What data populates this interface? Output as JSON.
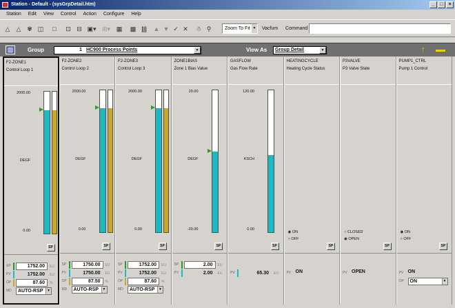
{
  "window": {
    "title": "Station - Default - (sysGrpDetail.htm)",
    "controls": [
      "_",
      "□",
      "×"
    ]
  },
  "menu": [
    "Station",
    "Edit",
    "View",
    "Control",
    "Action",
    "Configure",
    "Help"
  ],
  "toolbar": {
    "icons": [
      "alarm-bell-icon",
      "alarm-summary-icon",
      "operator-icon",
      "display-icon",
      "page-icon",
      "prev-display-icon",
      "next-display-icon",
      "history-icon",
      "back-icon",
      "forward-icon",
      "detail-icon",
      "trend-icon",
      "raise-icon",
      "lower-icon",
      "acknowledge-icon",
      "cancel-icon",
      "associated-display-icon",
      "find-icon"
    ],
    "zoom_value": "Zoom To Fit",
    "vacuum_label": "Vacfum",
    "command_label": "Command",
    "command_value": ""
  },
  "group_bar": {
    "group_label": "Group",
    "group_number": "1",
    "group_name": "HC900 Process Points",
    "view_label": "View As",
    "view_value": "Group Detail"
  },
  "row_labels": {
    "sp": "SP",
    "pv": "PV",
    "op": "OP",
    "mode": "MD"
  },
  "units": {
    "sp": "EU",
    "pv": "EU",
    "op": "%"
  },
  "columns": [
    {
      "name": "F2-ZONE1",
      "desc": "Control Loop 1",
      "type": "loop",
      "selected": true,
      "scale_hi": "2000.00",
      "scale_mid": "DEGF",
      "scale_lo": "0.00",
      "pv_fraction": 0.87,
      "sp_fraction": 0.87,
      "op_fraction": 0.87,
      "sp": "1752.00",
      "pv": "1752.00",
      "op": "87.60",
      "mode": "AUTO-RSP",
      "btn": "SP"
    },
    {
      "name": "F2-ZONE2",
      "desc": "Control Loop 2",
      "type": "loop",
      "selected": false,
      "scale_hi": "2000.00",
      "scale_mid": "DEGF",
      "scale_lo": "0.00",
      "pv_fraction": 0.875,
      "sp_fraction": 0.875,
      "op_fraction": 0.875,
      "sp": "1750.00",
      "pv": "1750.00",
      "op": "87.50",
      "mode": "AUTO-RSP",
      "btn": "SP"
    },
    {
      "name": "F2-ZONE3",
      "desc": "Control Loop 3",
      "type": "loop",
      "selected": false,
      "scale_hi": "2000.00",
      "scale_mid": "DEGF",
      "scale_lo": "0.00",
      "pv_fraction": 0.876,
      "sp_fraction": 0.876,
      "op_fraction": 0.876,
      "sp": "1752.00",
      "pv": "1752.00",
      "op": "87.60",
      "mode": "AUTO-RSP",
      "btn": "SP"
    },
    {
      "name": "ZONE1BIAS",
      "desc": "Zone 1 Bias Value",
      "type": "numeric",
      "selected": false,
      "scale_hi": "20.00",
      "scale_mid": "DEGF",
      "scale_lo": "-20.00",
      "pv_fraction": 0.57,
      "sp_fraction": 0.57,
      "sp": "2.00",
      "pv": "2.00",
      "btn": "SP"
    },
    {
      "name": "GASFLOW",
      "desc": "Gas Flow Rate",
      "type": "analog",
      "selected": false,
      "scale_hi": "120.00",
      "scale_mid": "KSCH",
      "scale_lo": "0.00",
      "pv_fraction": 0.545,
      "pv": "65.30",
      "btn": "SP"
    },
    {
      "name": "HEATINGCYCLE",
      "desc": "Heating Cycle Status",
      "type": "status",
      "selected": false,
      "opt1": "ON",
      "opt2": "OFF",
      "selected_opt": 1,
      "pv": "ON",
      "btn": "SP"
    },
    {
      "name": "P3VALVE",
      "desc": "P3 Valve State",
      "type": "status",
      "selected": false,
      "opt1": "CLOSED",
      "opt2": "OPEN",
      "selected_opt": 2,
      "pv": "OPEN",
      "btn": "SP"
    },
    {
      "name": "PUMP1_CTRL",
      "desc": "Pump 1 Control",
      "type": "control",
      "selected": false,
      "opt1": "ON",
      "opt2": "OFF",
      "selected_opt": 1,
      "pv": "ON",
      "op": "ON",
      "btn": "SP"
    }
  ],
  "colors": {
    "pv_fill": "#20b8c0",
    "op_fill": "#c8a828",
    "sp_marker": "#1fa020",
    "mode_bar": "#20b8c0"
  }
}
